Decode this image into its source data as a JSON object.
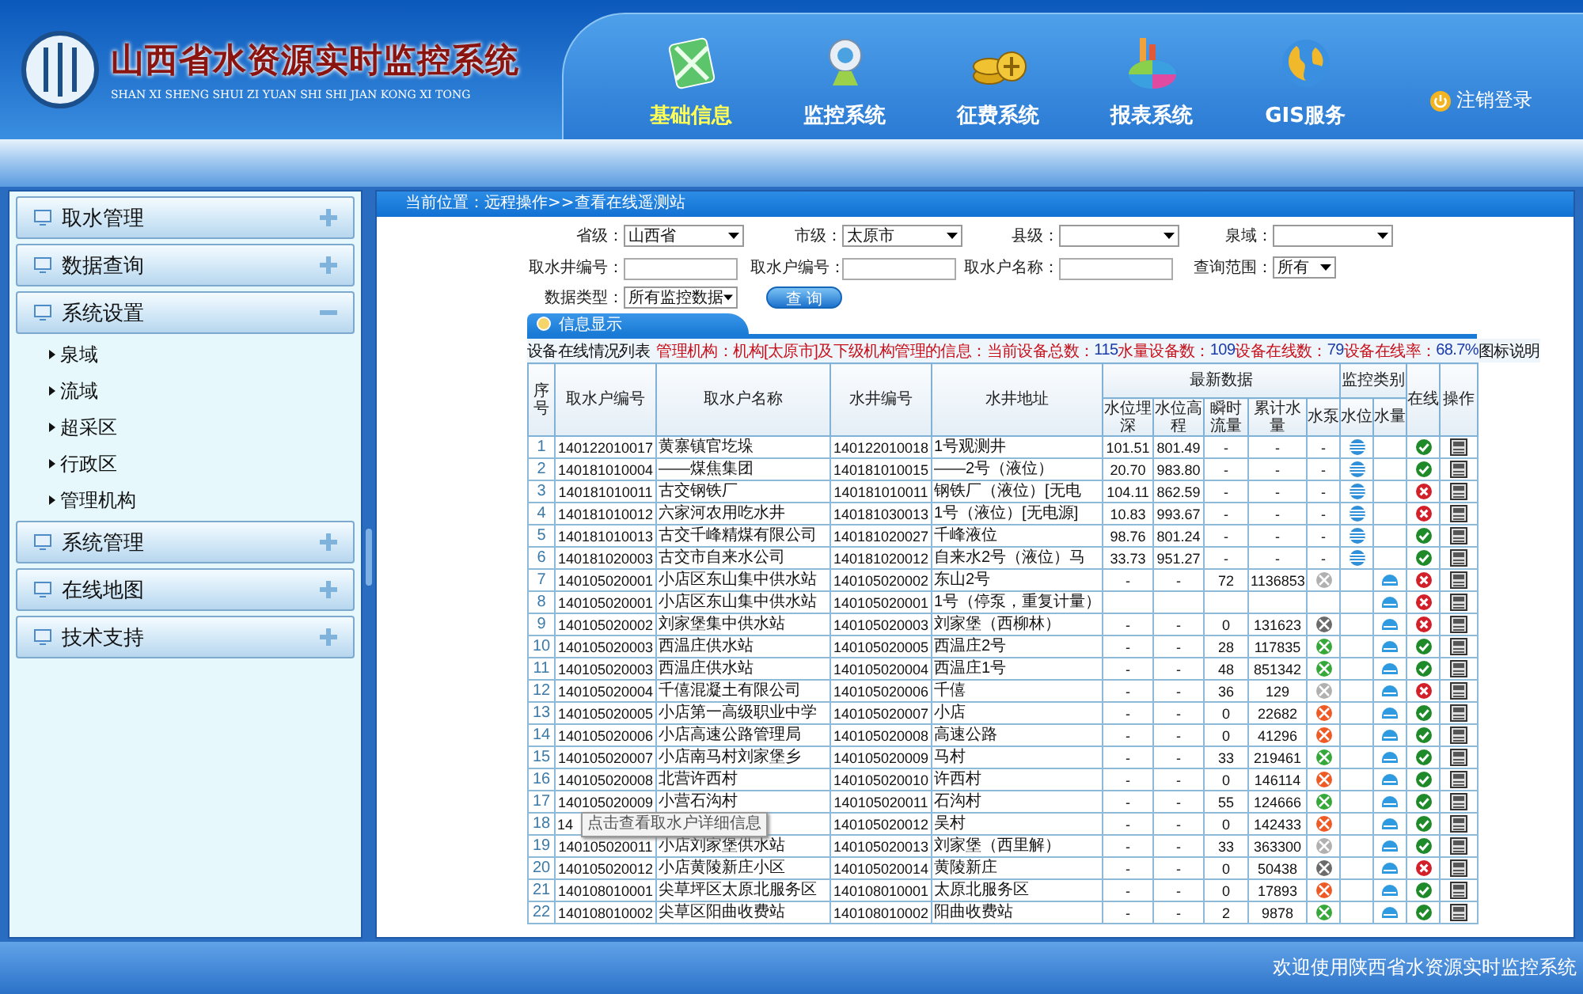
{
  "header": {
    "title": "山西省水资源实时监控系统",
    "subtitle": "SHAN XI SHENG SHUI ZI YUAN SHI SHI JIAN KONG XI TONG",
    "nav": [
      {
        "label": "基础信息",
        "selected": true
      },
      {
        "label": "监控系统",
        "selected": false
      },
      {
        "label": "征费系统",
        "selected": false
      },
      {
        "label": "报表系统",
        "selected": false
      },
      {
        "label": "GIS服务",
        "selected": false
      }
    ],
    "logout": "注销登录"
  },
  "sidebar": [
    {
      "label": "取水管理",
      "expanded": false
    },
    {
      "label": "数据查询",
      "expanded": false
    },
    {
      "label": "系统设置",
      "expanded": true,
      "children": [
        {
          "label": "泉域"
        },
        {
          "label": "流域"
        },
        {
          "label": "超采区"
        },
        {
          "label": "行政区"
        },
        {
          "label": "管理机构"
        }
      ]
    },
    {
      "label": "系统管理",
      "expanded": false
    },
    {
      "label": "在线地图",
      "expanded": false
    },
    {
      "label": "技术支持",
      "expanded": false
    }
  ],
  "breadcrumb": "当前位置：远程操作>>查看在线遥测站",
  "filters": [
    [
      {
        "label": "省级：",
        "kind": "select",
        "value": "山西省"
      },
      {
        "label": "市级：",
        "kind": "select",
        "value": "太原市"
      },
      {
        "label": "县级：",
        "kind": "select"
      },
      {
        "label": "泉域：",
        "kind": "select"
      }
    ],
    [
      {
        "label": "取水井编号：",
        "kind": "input"
      },
      {
        "label": "取水户编号：",
        "kind": "input"
      },
      {
        "label": "取水户名称：",
        "kind": "input"
      },
      {
        "label": "查询范围：",
        "kind": "small-select",
        "value": "所有"
      }
    ],
    [
      {
        "label": "数据类型：",
        "kind": "select",
        "value": "所有监控数据"
      }
    ]
  ],
  "query_button": "查 询",
  "panel": {
    "title": "信息显示",
    "summary": [
      {
        "text": "设备在线情况列表",
        "color": "#111111"
      },
      {
        "text": "管理机构：机构[太原市]及下级机构管理的信息：当前设备总数：",
        "color": "#c8101a"
      },
      {
        "text": "115",
        "color": "#1a3aa8"
      },
      {
        "text": "水量设备数：",
        "color": "#c8101a"
      },
      {
        "text": "109",
        "color": "#1a3aa8"
      },
      {
        "text": "设备在线数：",
        "color": "#c8101a"
      },
      {
        "text": "79",
        "color": "#1a3aa8"
      },
      {
        "text": "设备在线率：",
        "color": "#c8101a"
      },
      {
        "text": "68.7%",
        "color": "#1a3aa8"
      },
      {
        "text": "图标说明",
        "color": "#111111"
      }
    ],
    "columns": {
      "seq": "序号",
      "owner_code": "取水户编号",
      "owner_name": "取水户名称",
      "well_code": "水井编号",
      "address": "水井地址",
      "latest": "最新数据",
      "depth": "水位埋深",
      "elevation": "水位高程",
      "flow": "瞬时流量",
      "total": "累计水量",
      "pump": "水泵",
      "monitor": "监控类别",
      "level": "水位",
      "quantity": "水量",
      "online": "在线",
      "action": "操作"
    },
    "rows": [
      {
        "seq": "1",
        "owner_code": "140122010017",
        "owner_name": "黄寨镇官圪垛",
        "well_code": "140122010018",
        "address": "1号观测井",
        "depth": "101.51",
        "elevation": "801.49",
        "flow": "-",
        "total": "-",
        "pump": "-",
        "kind": "level",
        "online": true
      },
      {
        "seq": "2",
        "owner_code": "140181010004",
        "owner_name": "——煤焦集团",
        "well_code": "140181010015",
        "address": "——2号（液位）",
        "depth": "20.70",
        "elevation": "983.80",
        "flow": "-",
        "total": "-",
        "pump": "-",
        "kind": "level",
        "online": true
      },
      {
        "seq": "3",
        "owner_code": "140181010011",
        "owner_name": "古交钢铁厂",
        "well_code": "140181010011",
        "address": "钢铁厂（液位）[无电",
        "depth": "104.11",
        "elevation": "862.59",
        "flow": "-",
        "total": "-",
        "pump": "-",
        "kind": "level",
        "online": false
      },
      {
        "seq": "4",
        "owner_code": "140181010012",
        "owner_name": "六家河农用吃水井",
        "well_code": "140181030013",
        "address": "1号（液位）[无电源]",
        "depth": "10.83",
        "elevation": "993.67",
        "flow": "-",
        "total": "-",
        "pump": "-",
        "kind": "level",
        "online": false
      },
      {
        "seq": "5",
        "owner_code": "140181010013",
        "owner_name": "古交千峰精煤有限公司",
        "well_code": "140181020027",
        "address": "千峰液位",
        "depth": "98.76",
        "elevation": "801.24",
        "flow": "-",
        "total": "-",
        "pump": "-",
        "kind": "level",
        "online": true
      },
      {
        "seq": "6",
        "owner_code": "140181020003",
        "owner_name": "古交市自来水公司",
        "well_code": "140181020012",
        "address": "自来水2号（液位）马",
        "depth": "33.73",
        "elevation": "951.27",
        "flow": "-",
        "total": "-",
        "pump": "-",
        "kind": "level",
        "online": true
      },
      {
        "seq": "7",
        "owner_code": "140105020001",
        "owner_name": "小店区东山集中供水站",
        "well_code": "140105020002",
        "address": "东山2号",
        "depth": "-",
        "elevation": "-",
        "flow": "72",
        "total": "1136853",
        "pump": {
          "color": "#b0b0b0"
        },
        "kind": "quantity",
        "online": false
      },
      {
        "seq": "8",
        "owner_code": "140105020001",
        "owner_name": "小店区东山集中供水站",
        "well_code": "140105020001",
        "address": "1号（停泵，重复计量）",
        "kind": "quantity",
        "online": false
      },
      {
        "seq": "9",
        "owner_code": "140105020002",
        "owner_name": "刘家堡集中供水站",
        "well_code": "140105020003",
        "address": "刘家堡（西柳林）",
        "depth": "-",
        "elevation": "-",
        "flow": "0",
        "total": "131623",
        "pump": {
          "color": "#6a6a6a"
        },
        "kind": "quantity",
        "online": false
      },
      {
        "seq": "10",
        "owner_code": "140105020003",
        "owner_name": "西温庄供水站",
        "well_code": "140105020005",
        "address": "西温庄2号",
        "depth": "-",
        "elevation": "-",
        "flow": "28",
        "total": "117835",
        "pump": {
          "color": "#36a83a"
        },
        "kind": "quantity",
        "online": true
      },
      {
        "seq": "11",
        "owner_code": "140105020003",
        "owner_name": "西温庄供水站",
        "well_code": "140105020004",
        "address": "西温庄1号",
        "depth": "-",
        "elevation": "-",
        "flow": "48",
        "total": "851342",
        "pump": {
          "color": "#36a83a"
        },
        "kind": "quantity",
        "online": true
      },
      {
        "seq": "12",
        "owner_code": "140105020004",
        "owner_name": "千僖混凝土有限公司",
        "well_code": "140105020006",
        "address": "千僖",
        "depth": "-",
        "elevation": "-",
        "flow": "36",
        "total": "129",
        "pump": {
          "color": "#b0b0b0"
        },
        "kind": "quantity",
        "online": false
      },
      {
        "seq": "13",
        "owner_code": "140105020005",
        "owner_name": "小店第一高级职业中学",
        "well_code": "140105020007",
        "address": "小店",
        "depth": "-",
        "elevation": "-",
        "flow": "0",
        "total": "22682",
        "pump": {
          "color": "#ee5a24"
        },
        "kind": "quantity",
        "online": true
      },
      {
        "seq": "14",
        "owner_code": "140105020006",
        "owner_name": "小店高速公路管理局",
        "well_code": "140105020008",
        "address": "高速公路",
        "depth": "-",
        "elevation": "-",
        "flow": "0",
        "total": "41296",
        "pump": {
          "color": "#ee5a24"
        },
        "kind": "quantity",
        "online": true
      },
      {
        "seq": "15",
        "owner_code": "140105020007",
        "owner_name": "小店南马村刘家堡乡",
        "well_code": "140105020009",
        "address": "马村",
        "depth": "-",
        "elevation": "-",
        "flow": "33",
        "total": "219461",
        "pump": {
          "color": "#36a83a"
        },
        "kind": "quantity",
        "online": true
      },
      {
        "seq": "16",
        "owner_code": "140105020008",
        "owner_name": "北营许西村",
        "well_code": "140105020010",
        "address": "许西村",
        "depth": "-",
        "elevation": "-",
        "flow": "0",
        "total": "146114",
        "pump": {
          "color": "#ee5a24"
        },
        "kind": "quantity",
        "online": true
      },
      {
        "seq": "17",
        "owner_code": "140105020009",
        "owner_name": "小营石沟村",
        "well_code": "140105020011",
        "address": "石沟村",
        "depth": "-",
        "elevation": "-",
        "flow": "55",
        "total": "124666",
        "pump": {
          "color": "#36a83a"
        },
        "kind": "quantity",
        "online": true
      },
      {
        "seq": "18",
        "owner_code": "14",
        "tooltip": "点击查看取水户详细信息",
        "well_code": "140105020012",
        "address": "吴村",
        "depth": "-",
        "elevation": "-",
        "flow": "0",
        "total": "142433",
        "pump": {
          "color": "#ee5a24"
        },
        "kind": "quantity",
        "online": true
      },
      {
        "seq": "19",
        "owner_code": "140105020011",
        "owner_name": "小店刘家堡供水站",
        "well_code": "140105020013",
        "address": "刘家堡（西里解）",
        "depth": "-",
        "elevation": "-",
        "flow": "33",
        "total": "363300",
        "pump": {
          "color": "#b0b0b0"
        },
        "kind": "quantity",
        "online": true
      },
      {
        "seq": "20",
        "owner_code": "140105020012",
        "owner_name": "小店黄陵新庄小区",
        "well_code": "140105020014",
        "address": "黄陵新庄",
        "depth": "-",
        "elevation": "-",
        "flow": "0",
        "total": "50438",
        "pump": {
          "color": "#6a6a6a"
        },
        "kind": "quantity",
        "online": false
      },
      {
        "seq": "21",
        "owner_code": "140108010001",
        "owner_name": "尖草坪区太原北服务区",
        "well_code": "140108010001",
        "address": "太原北服务区",
        "depth": "-",
        "elevation": "-",
        "flow": "0",
        "total": "17893",
        "pump": {
          "color": "#ee5a24"
        },
        "kind": "quantity",
        "online": true
      },
      {
        "seq": "22",
        "owner_code": "140108010002",
        "owner_name": "尖草区阳曲收费站",
        "well_code": "140108010002",
        "address": "阳曲收费站",
        "depth": "-",
        "elevation": "-",
        "flow": "2",
        "total": "9878",
        "pump": {
          "color": "#36a83a"
        },
        "kind": "quantity",
        "online": true
      }
    ]
  },
  "footer": "欢迎使用陕西省水资源实时监控系统"
}
